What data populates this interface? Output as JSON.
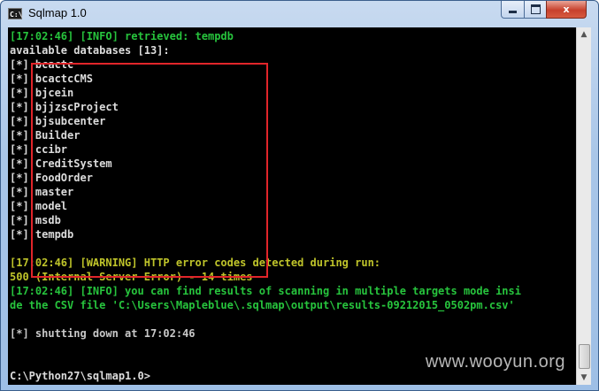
{
  "window": {
    "title": "Sqlmap 1.0",
    "icon_text": "C:\\",
    "buttons": {
      "minimize": "minimize-icon",
      "maximize": "maximize-icon",
      "close": "close-icon",
      "close_glyph": "x"
    }
  },
  "console": {
    "lines": [
      {
        "text": "[17:02:46] [INFO] retrieved: tempdb",
        "color": "green"
      },
      {
        "text": "available databases [13]:",
        "color": "white"
      },
      {
        "text": "[*] bcactc",
        "color": "white"
      },
      {
        "text": "[*] bcactcCMS",
        "color": "white"
      },
      {
        "text": "[*] bjcein",
        "color": "white"
      },
      {
        "text": "[*] bjjzscProject",
        "color": "white"
      },
      {
        "text": "[*] bjsubcenter",
        "color": "white"
      },
      {
        "text": "[*] Builder",
        "color": "white"
      },
      {
        "text": "[*] ccibr",
        "color": "white"
      },
      {
        "text": "[*] CreditSystem",
        "color": "white"
      },
      {
        "text": "[*] FoodOrder",
        "color": "white"
      },
      {
        "text": "[*] master",
        "color": "white"
      },
      {
        "text": "[*] model",
        "color": "white"
      },
      {
        "text": "[*] msdb",
        "color": "white"
      },
      {
        "text": "[*] tempdb",
        "color": "white"
      },
      {
        "text": "",
        "color": "white"
      },
      {
        "text": "[17:02:46] [WARNING] HTTP error codes detected during run:",
        "color": "yellow"
      },
      {
        "text": "500 (Internal Server Error) - 14 times",
        "color": "yellow"
      },
      {
        "text": "[17:02:46] [INFO] you can find results of scanning in multiple targets mode insi",
        "color": "green"
      },
      {
        "text": "de the CSV file 'C:\\Users\\Mapleblue\\.sqlmap\\output\\results-09212015_0502pm.csv'",
        "color": "green"
      },
      {
        "text": "",
        "color": "white"
      },
      {
        "text": "[*] shutting down at 17:02:46",
        "color": "gray"
      },
      {
        "text": "",
        "color": "white"
      },
      {
        "text": "",
        "color": "white"
      },
      {
        "text": "C:\\Python27\\sqlmap1.0>",
        "color": "white"
      }
    ]
  },
  "scrollbar": {
    "up_icon": "scroll-up-arrow-icon",
    "down_icon": "scroll-down-arrow-icon",
    "up_glyph": "▲",
    "down_glyph": "▼"
  },
  "watermark": "www.wooyun.org",
  "colors": {
    "green": "#27c43d",
    "yellow": "#bfc42a",
    "white": "#dcdcdc",
    "gray": "#c8c8c8",
    "highlight_border": "#e1252a",
    "console_bg": "#000000"
  }
}
